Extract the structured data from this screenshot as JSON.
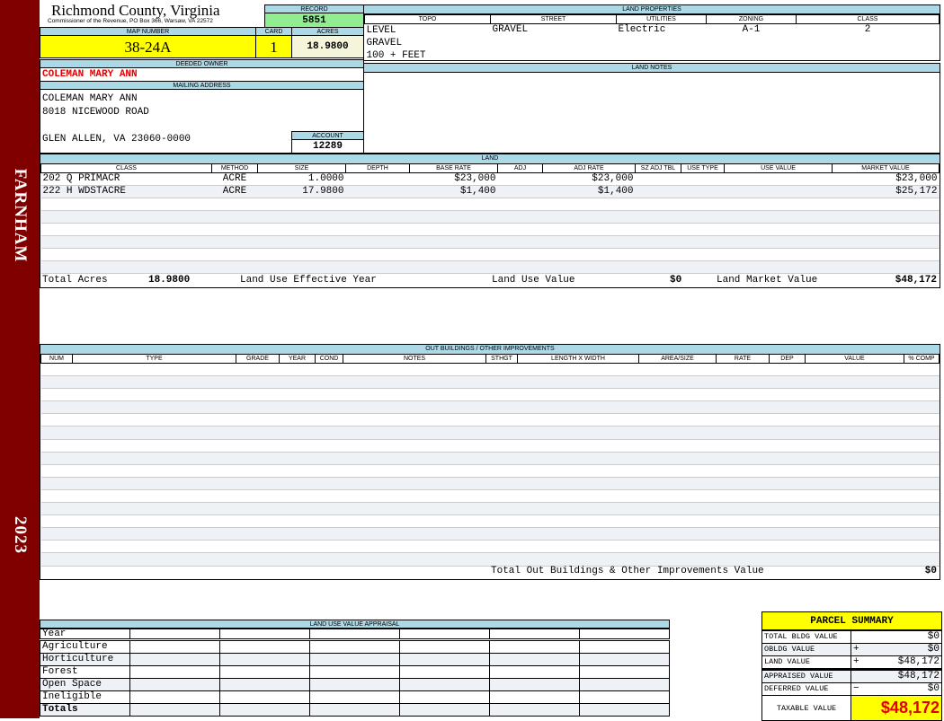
{
  "sidebar": {
    "district": "FARNHAM",
    "year": "2023",
    "color": "#800000"
  },
  "header": {
    "title": "Richmond County, Virginia",
    "subtitle": "Commissioner of the Revenue, PO Box 366, Warsaw, VA 22572"
  },
  "record": {
    "label": "RECORD",
    "value": "5851"
  },
  "parcel": {
    "map_label": "MAP NUMBER",
    "map_number": "38-24A",
    "card_label": "CARD",
    "card": "1",
    "acres_label": "ACRES",
    "acres": "18.9800"
  },
  "owner": {
    "label": "DEEDED OWNER",
    "name": "COLEMAN MARY ANN"
  },
  "mailing": {
    "label": "MAILING ADDRESS",
    "line1": "COLEMAN MARY ANN",
    "line2": "8018 NICEWOOD ROAD",
    "line3": "GLEN ALLEN, VA 23060-0000"
  },
  "account": {
    "label": "ACCOUNT",
    "value": "12289"
  },
  "land_properties": {
    "label": "LAND PROPERTIES",
    "headers": [
      "TOPO",
      "STREET",
      "UTILITIES",
      "ZONING",
      "CLASS"
    ],
    "topo": [
      "LEVEL",
      "GRAVEL",
      "100 + FEET"
    ],
    "street": "GRAVEL",
    "utilities": "Electric",
    "zoning": "A-1",
    "class": "2"
  },
  "land_notes": {
    "label": "LAND NOTES"
  },
  "land": {
    "label": "LAND",
    "headers": [
      "CLASS",
      "METHOD",
      "SIZE",
      "DEPTH",
      "BASE RATE",
      "ADJ",
      "ADJ RATE",
      "SZ ADJ TBL",
      "USE TYPE",
      "USE VALUE",
      "MARKET VALUE"
    ],
    "rows": [
      [
        "202 Q PRIMACR",
        "ACRE",
        "1.0000",
        "",
        "$23,000",
        "",
        "$23,000",
        "",
        "",
        "",
        "$23,000"
      ],
      [
        "222 H WDSTACRE",
        "ACRE",
        "17.9800",
        "",
        "$1,400",
        "",
        "$1,400",
        "",
        "",
        "",
        "$25,172"
      ]
    ],
    "totals": {
      "acres_label": "Total Acres",
      "acres": "18.9800",
      "effective_year_label": "Land Use Effective Year",
      "effective_year": "",
      "use_value_label": "Land Use Value",
      "use_value": "$0",
      "market_value_label": "Land Market Value",
      "market_value": "$48,172"
    }
  },
  "outbuildings": {
    "label": "OUT BUILDINGS / OTHER IMPROVEMENTS",
    "headers": [
      "NUM",
      "TYPE",
      "GRADE",
      "YEAR",
      "COND",
      "NOTES",
      "STHGT",
      "LENGTH X WIDTH",
      "AREA/SIZE",
      "RATE",
      "DEP",
      "VALUE",
      "% COMP"
    ],
    "rows": [],
    "total_label": "Total Out Buildings & Other Improvements Value",
    "total": "$0"
  },
  "land_use_appraisal": {
    "label": "LAND USE VALUE APPRAISAL",
    "year_label": "Year",
    "rows": [
      "Agriculture",
      "Horticulture",
      "Forest",
      "Open Space",
      "Ineligible"
    ],
    "totals_label": "Totals"
  },
  "parcel_summary": {
    "title": "PARCEL SUMMARY",
    "rows": [
      {
        "label": "TOTAL BLDG VALUE",
        "sign": "",
        "value": "$0"
      },
      {
        "label": "OBLDG VALUE",
        "sign": "+",
        "value": "$0"
      },
      {
        "label": "LAND VALUE",
        "sign": "+",
        "value": "$48,172"
      },
      {
        "label": "APPRAISED VALUE",
        "sign": "",
        "value": "$48,172"
      },
      {
        "label": "DEFERRED VALUE",
        "sign": "−",
        "value": "$0"
      }
    ],
    "taxable_label": "TAXABLE VALUE",
    "taxable_value": "$48,172"
  }
}
